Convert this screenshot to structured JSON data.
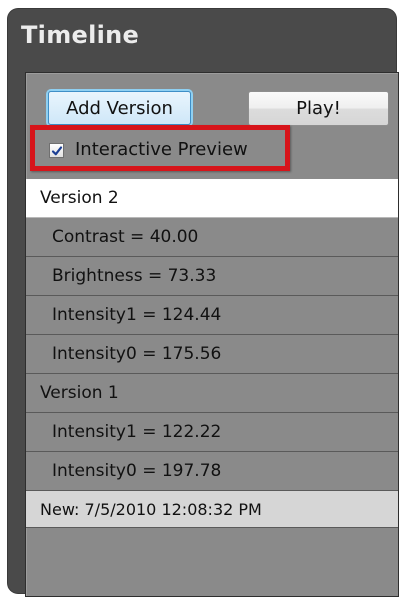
{
  "panel": {
    "title": "Timeline"
  },
  "toolbar": {
    "add_version_label": "Add Version",
    "play_label": "Play!"
  },
  "preview": {
    "checkbox_label": "Interactive Preview",
    "checked": true
  },
  "timeline": {
    "versions": [
      {
        "label": "Version 2",
        "selected": true,
        "items": [
          "Contrast = 40.00",
          "Brightness = 73.33",
          "Intensity1 = 124.44",
          "Intensity0 = 175.56"
        ]
      },
      {
        "label": "Version 1",
        "selected": false,
        "items": [
          "Intensity1 = 122.22",
          "Intensity0 = 197.78"
        ]
      }
    ],
    "new_entry": "New: 7/5/2010 12:08:32 PM"
  },
  "colors": {
    "highlight": "#d7141a",
    "panel_background": "#8a8a8a",
    "frame_background": "#4a4a4a",
    "selection": "#ffffff"
  },
  "icons": {
    "checkbox": "check-icon"
  }
}
